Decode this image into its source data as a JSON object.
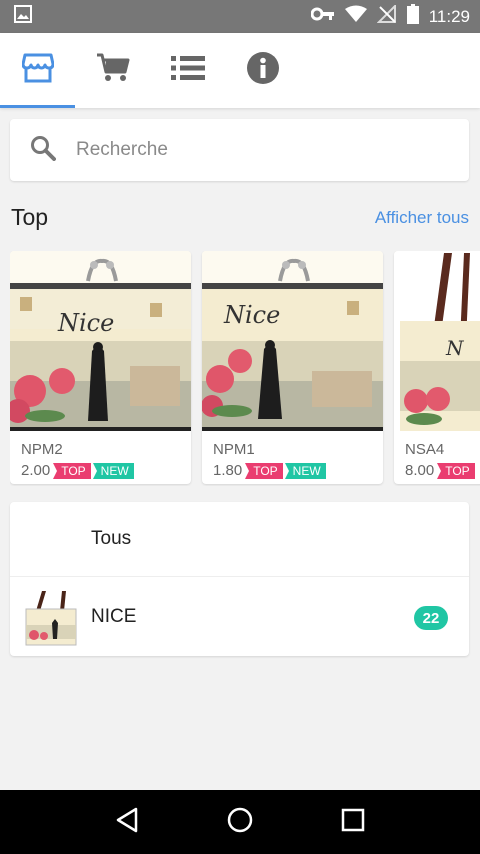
{
  "status_bar": {
    "time": "11:29",
    "icons": [
      "image-icon",
      "vpn-key-icon",
      "wifi-icon",
      "no-signal-icon",
      "battery-icon"
    ]
  },
  "tabs": [
    {
      "icon": "store-icon",
      "active": true
    },
    {
      "icon": "cart-icon",
      "active": false
    },
    {
      "icon": "list-icon",
      "active": false
    },
    {
      "icon": "info-icon",
      "active": false
    }
  ],
  "search": {
    "placeholder": "Recherche"
  },
  "top_section": {
    "title": "Top",
    "see_all": "Afficher tous"
  },
  "products": [
    {
      "name": "NPM2",
      "price": "2.00",
      "badges": [
        "TOP",
        "NEW"
      ]
    },
    {
      "name": "NPM1",
      "price": "1.80",
      "badges": [
        "TOP",
        "NEW"
      ]
    },
    {
      "name": "NSA4",
      "price": "8.00",
      "badges": [
        "TOP"
      ]
    }
  ],
  "categories": {
    "all_label": "Tous",
    "items": [
      {
        "label": "NICE",
        "count": "22"
      }
    ]
  },
  "colors": {
    "accent": "#4a90e2",
    "top_badge": "#ea3d70",
    "new_badge": "#20c6a4",
    "status_bar": "#777777"
  }
}
